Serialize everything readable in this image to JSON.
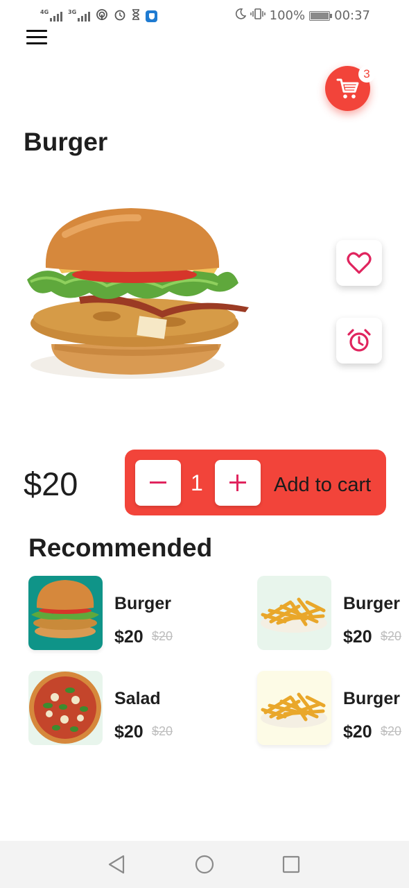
{
  "status_bar": {
    "network_1": "4G",
    "network_2": "3G",
    "battery": "100%",
    "time": "00:37"
  },
  "header": {
    "cart_count": "3"
  },
  "product": {
    "title": "Burger",
    "price": "$20",
    "quantity": "1",
    "add_to_cart_label": "Add to cart"
  },
  "recommended": {
    "title": "Recommended",
    "items": [
      {
        "name": "Burger",
        "price": "$20",
        "old_price": "$20",
        "image": "burger",
        "bg": "#0f9488"
      },
      {
        "name": "Burger",
        "price": "$20",
        "old_price": "$20",
        "image": "fries",
        "bg": "#e8f5ec"
      },
      {
        "name": "Salad",
        "price": "$20",
        "old_price": "$20",
        "image": "pizza",
        "bg": "#e8f5ec"
      },
      {
        "name": "Burger",
        "price": "$20",
        "old_price": "$20",
        "image": "fries",
        "bg": "#fdfbe6"
      }
    ]
  },
  "colors": {
    "accent": "#f2443a",
    "icon_pink": "#e0245e"
  },
  "icons": [
    "menu-icon",
    "cart-icon",
    "heart-icon",
    "alarm-clock-icon",
    "minus-icon",
    "plus-icon",
    "back-icon",
    "home-icon",
    "recents-icon"
  ]
}
